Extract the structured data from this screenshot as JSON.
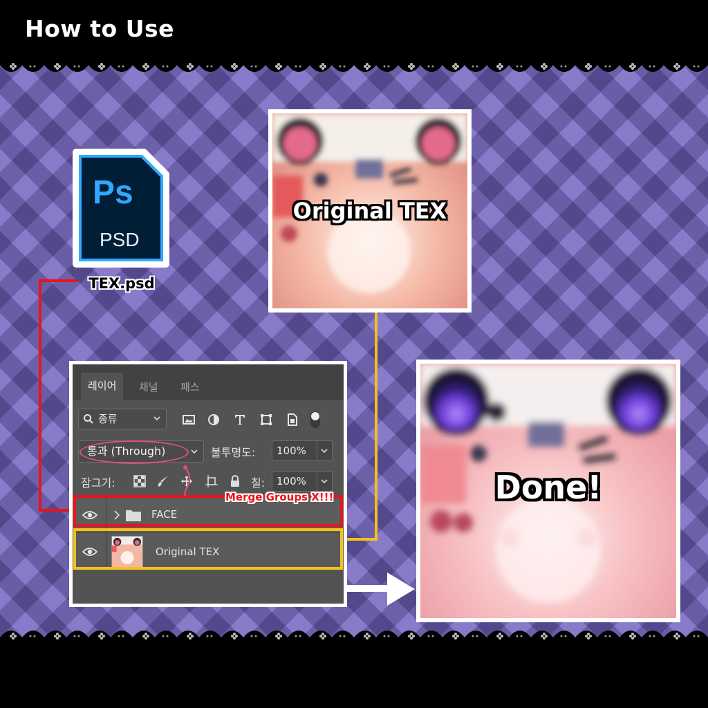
{
  "header": {
    "title": "How to Use"
  },
  "psd_file": {
    "icon_label": "Ps",
    "icon_sublabel": "PSD",
    "filename": "TEX.psd"
  },
  "textures": {
    "original_caption": "Original TEX",
    "done_caption": "Done!"
  },
  "layers_panel": {
    "tabs": [
      {
        "label": "레이어",
        "active": true
      },
      {
        "label": "채널",
        "active": false
      },
      {
        "label": "패스",
        "active": false
      }
    ],
    "filter_kind": "종류",
    "blend_mode": "통과 (Through)",
    "opacity_label": "불투명도:",
    "opacity_value": "100%",
    "lock_label": "잠그기:",
    "fill_label": "칠:",
    "fill_value": "100%",
    "layers": [
      {
        "name": "FACE",
        "type": "group",
        "visible": true
      },
      {
        "name": "Original TEX",
        "type": "image",
        "visible": true
      }
    ]
  },
  "annotations": {
    "merge_warning": "Merge Groups X!!!"
  },
  "colors": {
    "background": "#7c6cc4",
    "red_highlight": "#e8141c",
    "yellow_highlight": "#f2c21a",
    "blend_circle": "#e24d8e",
    "ps_blue": "#31a8ff",
    "ps_dark": "#001e36"
  },
  "icons": [
    "ps-file-icon",
    "search-icon",
    "image-filter-icon",
    "adjustment-filter-icon",
    "type-filter-icon",
    "shape-filter-icon",
    "smart-object-filter-icon",
    "filter-toggle-icon",
    "lock-transparent-icon",
    "lock-brush-icon",
    "lock-position-icon",
    "lock-artboard-icon",
    "lock-all-icon",
    "eye-icon",
    "folder-icon",
    "chevron-right-icon",
    "arrow-right-icon"
  ]
}
